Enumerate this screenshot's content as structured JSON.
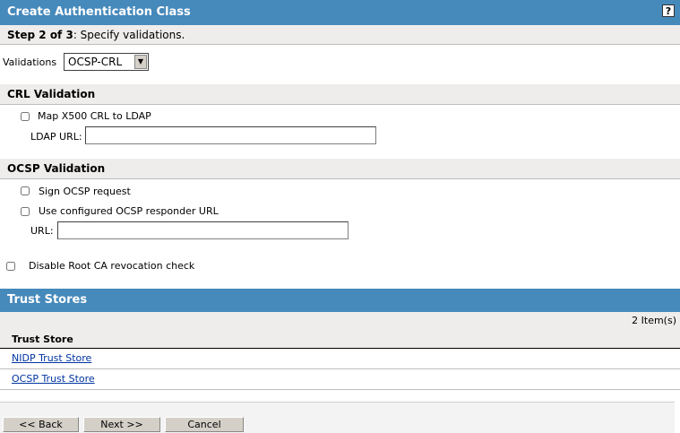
{
  "header": {
    "title": "Create Authentication Class",
    "help_label": "?"
  },
  "step": {
    "prefix": "Step 2 of 3",
    "text": ": Specify validations."
  },
  "validations": {
    "label": "Validations",
    "selected": "OCSP-CRL"
  },
  "crl": {
    "title": "CRL Validation",
    "map_label": "Map X500 CRL to LDAP",
    "ldap_url_label": "LDAP URL:",
    "ldap_url_value": ""
  },
  "ocsp": {
    "title": "OCSP Validation",
    "sign_label": "Sign OCSP request",
    "use_configured_label": "Use configured OCSP responder URL",
    "url_label": "URL:",
    "url_value": ""
  },
  "disable_root": {
    "label": "Disable Root CA revocation check"
  },
  "trust": {
    "title": "Trust Stores",
    "count": "2 Item(s)",
    "column": "Trust Store",
    "items": [
      "NIDP Trust Store",
      "OCSP Trust Store"
    ]
  },
  "buttons": {
    "back": "<< Back",
    "next": "Next >>",
    "cancel": "Cancel"
  }
}
